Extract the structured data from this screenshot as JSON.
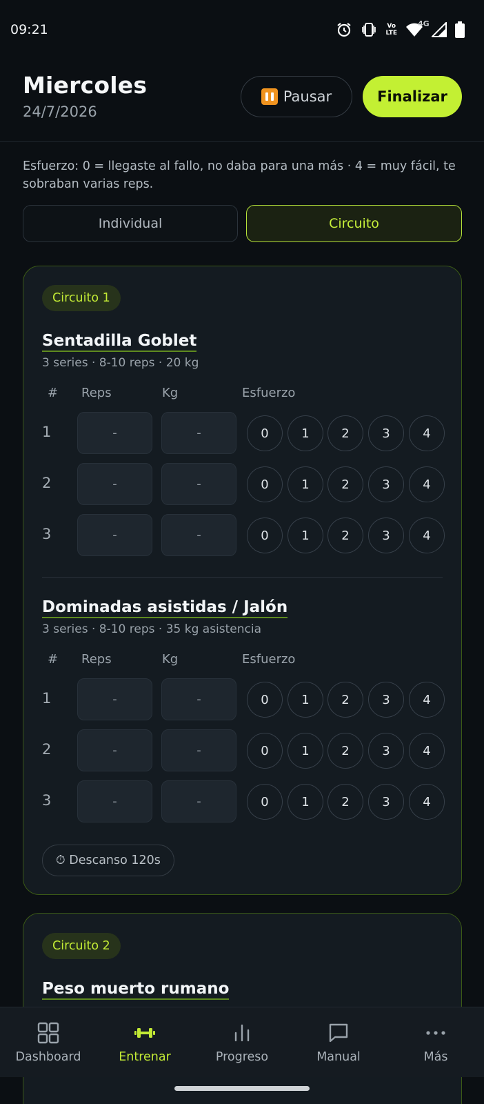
{
  "status_bar": {
    "time": "09:21",
    "icons": [
      "alarm-icon",
      "vibrate-icon",
      "volte-icon",
      "wifi-icon",
      "signal-4g-icon",
      "battery-icon"
    ],
    "network_label": "4G",
    "volte_label_top": "Vo",
    "volte_label_bottom": "LTE"
  },
  "header": {
    "title": "Miercoles",
    "date": "24/7/2026",
    "pause_label": "Pausar",
    "finish_label": "Finalizar"
  },
  "effort_help": "Esfuerzo: 0 = llegaste al fallo, no daba para una más · 4 = muy fácil, te sobraban varias reps.",
  "mode_tabs": [
    {
      "label": "Individual",
      "active": false
    },
    {
      "label": "Circuito",
      "active": true
    }
  ],
  "columns": {
    "num": "#",
    "reps": "Reps",
    "kg": "Kg",
    "effort": "Esfuerzo"
  },
  "effort_options": [
    "0",
    "1",
    "2",
    "3",
    "4"
  ],
  "circuits": [
    {
      "badge": "Circuito 1",
      "exercises": [
        {
          "name": "Sentadilla Goblet",
          "meta": "3 series · 8-10 reps · 20 kg",
          "sets": [
            {
              "num": "1",
              "reps": "-",
              "kg": "-"
            },
            {
              "num": "2",
              "reps": "-",
              "kg": "-"
            },
            {
              "num": "3",
              "reps": "-",
              "kg": "-"
            }
          ]
        },
        {
          "name": "Dominadas asistidas / Jalón",
          "meta": "3 series · 8-10 reps · 35 kg asistencia",
          "sets": [
            {
              "num": "1",
              "reps": "-",
              "kg": "-"
            },
            {
              "num": "2",
              "reps": "-",
              "kg": "-"
            },
            {
              "num": "3",
              "reps": "-",
              "kg": "-"
            }
          ]
        }
      ],
      "rest": "⏱ Descanso 120s"
    },
    {
      "badge": "Circuito 2",
      "exercises": [
        {
          "name": "Peso muerto rumano"
        }
      ]
    }
  ],
  "nav": [
    {
      "label": "Dashboard",
      "icon": "dashboard-grid-icon",
      "active": false
    },
    {
      "label": "Entrenar",
      "icon": "dumbbell-icon",
      "active": true
    },
    {
      "label": "Progreso",
      "icon": "bar-chart-icon",
      "active": false
    },
    {
      "label": "Manual",
      "icon": "chat-bubble-icon",
      "active": false
    },
    {
      "label": "Más",
      "icon": "more-dots-icon",
      "active": false
    }
  ],
  "colors": {
    "accent": "#c3f033",
    "background": "#0b0f13",
    "card": "#141b21",
    "pause_icon": "#f0931f"
  }
}
